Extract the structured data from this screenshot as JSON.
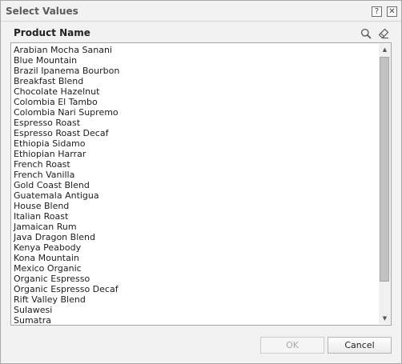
{
  "window": {
    "title": "Select Values",
    "help_glyph": "?",
    "close_glyph": "✕"
  },
  "panel": {
    "header": "Product Name",
    "icons": [
      "search-icon",
      "clear-filter-icon"
    ]
  },
  "list": {
    "items": [
      "Arabian Mocha Sanani",
      "Blue Mountain",
      "Brazil Ipanema Bourbon",
      "Breakfast Blend",
      "Chocolate Hazelnut",
      "Colombia El Tambo",
      "Colombia Nari Supremo",
      "Espresso Roast",
      "Espresso Roast Decaf",
      "Ethiopia Sidamo",
      "Ethiopian Harrar",
      "French Roast",
      "French Vanilla",
      "Gold Coast Blend",
      "Guatemala Antigua",
      "House Blend",
      "Italian Roast",
      "Jamaican Rum",
      "Java Dragon Blend",
      "Kenya Peabody",
      "Kona Mountain",
      "Mexico Organic",
      "Organic Espresso",
      "Organic Espresso Decaf",
      "Rift Valley Blend",
      "Sulawesi",
      "Sumatra"
    ],
    "scroll_up_glyph": "▲",
    "scroll_down_glyph": "▼"
  },
  "footer": {
    "ok_label": "OK",
    "cancel_label": "Cancel",
    "ok_disabled": true
  }
}
